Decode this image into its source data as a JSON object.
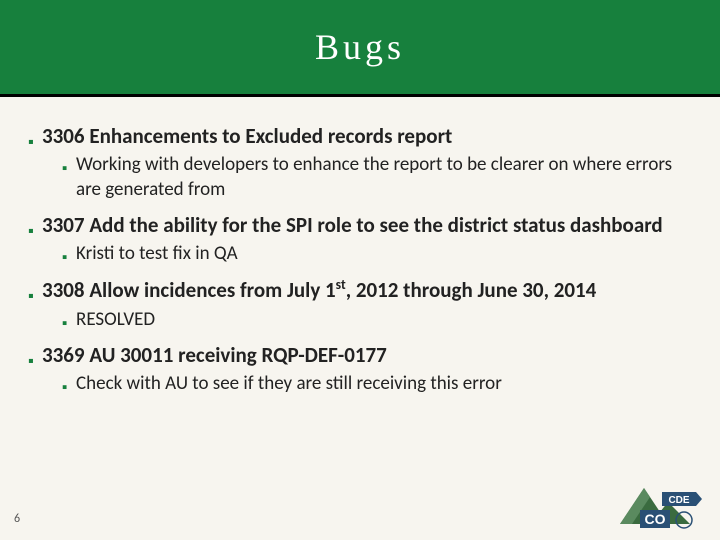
{
  "title": "Bugs",
  "page_number": "6",
  "items": [
    {
      "label": "3306 Enhancements to Excluded records report",
      "sub": [
        "Working with developers to enhance the report to be clearer on where errors are generated from"
      ]
    },
    {
      "label": "3307 Add the ability for the SPI role to see the district status dashboard",
      "sub": [
        "Kristi to test fix in QA"
      ]
    },
    {
      "label_html": "3308 Allow incidences from July 1<span class=\"sup\">st</span>, 2012 through June 30, 2014",
      "label": "3308 Allow incidences from July 1st, 2012 through June 30, 2014",
      "sub": [
        "RESOLVED"
      ]
    },
    {
      "label": "3369 AU 30011 receiving RQP-DEF-0177",
      "sub": [
        "Check with AU to see if they are still receiving this error"
      ]
    }
  ],
  "logo": {
    "co_text": "CO",
    "cde_text": "CDE",
    "mountain_color": "#3a6b3f",
    "banner_color": "#2a5075"
  }
}
